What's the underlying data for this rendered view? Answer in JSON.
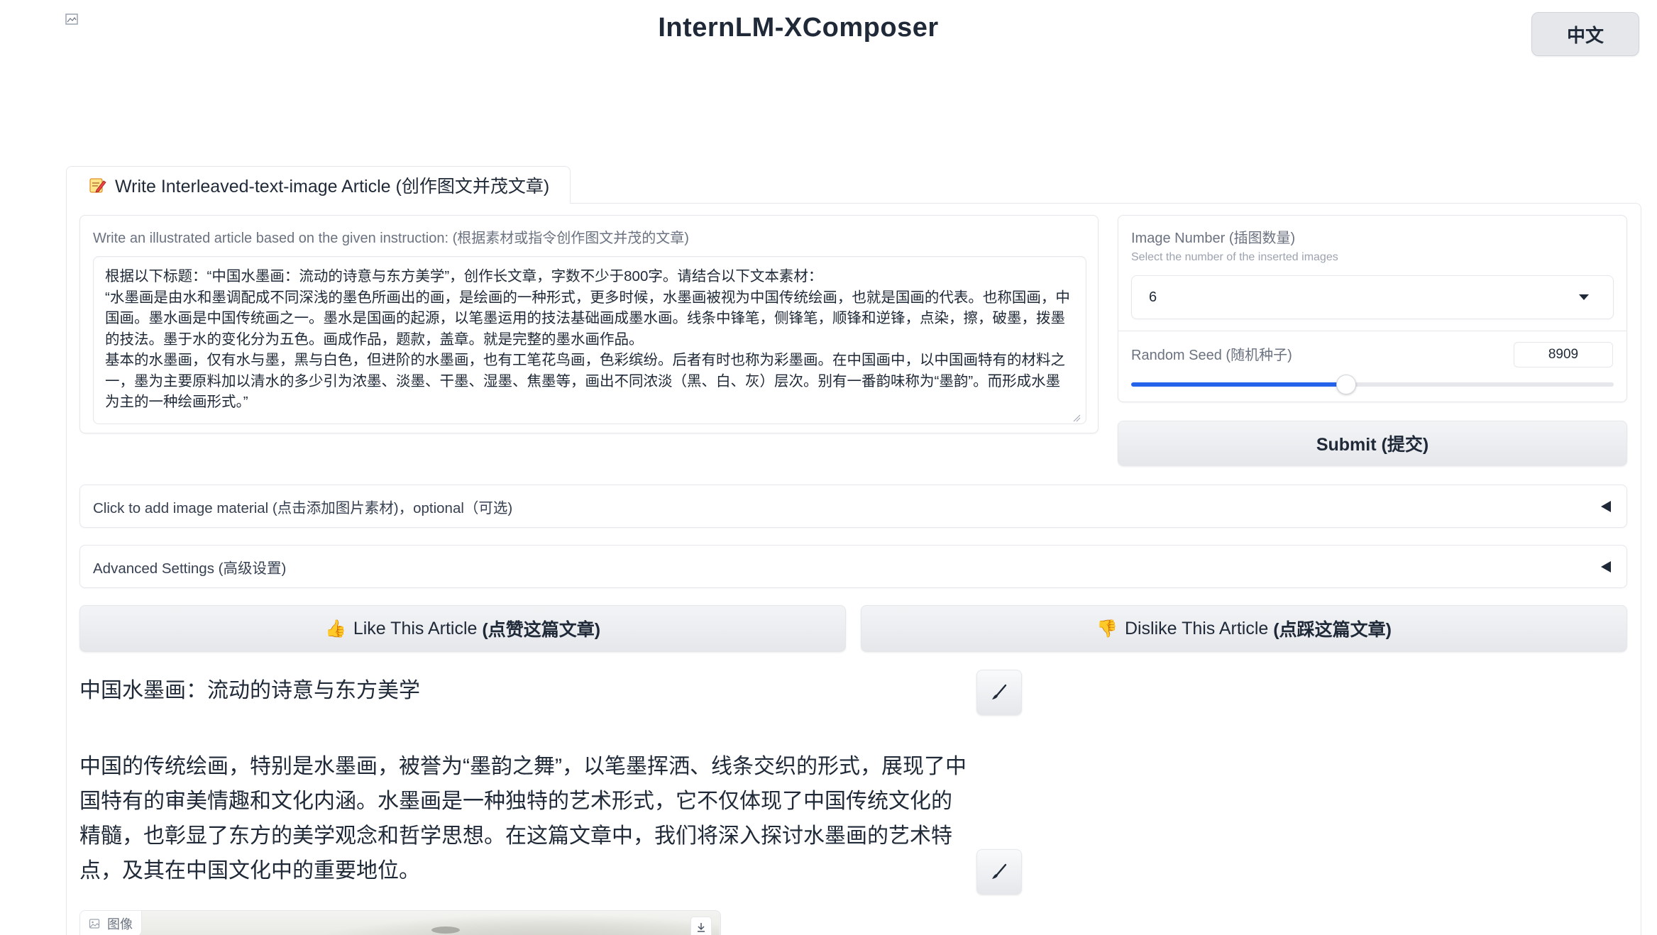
{
  "header": {
    "title": "InternLM-XComposer",
    "language_button": "中文"
  },
  "tabs": [
    {
      "label": "Write Interleaved-text-image Article (创作图文并茂文章)",
      "icon": "pencil-memo-icon"
    }
  ],
  "instruction": {
    "label": "Write an illustrated article based on the given instruction: (根据素材或指令创作图文并茂的文章)",
    "value": "根据以下标题：“中国水墨画：流动的诗意与东方美学”，创作长文章，字数不少于800字。请结合以下文本素材：\n“水墨画是由水和墨调配成不同深浅的墨色所画出的画，是绘画的一种形式，更多时候，水墨画被视为中国传统绘画，也就是国画的代表。也称国画，中国画。墨水画是中国传统画之一。墨水是国画的起源，以笔墨运用的技法基础画成墨水画。线条中锋笔，侧锋笔，顺锋和逆锋，点染，擦，破墨，拨墨的技法。墨于水的变化分为五色。画成作品，题款，盖章。就是完整的墨水画作品。\n基本的水墨画，仅有水与墨，黑与白色，但进阶的水墨画，也有工笔花鸟画，色彩缤纷。后者有时也称为彩墨画。在中国画中，以中国画特有的材料之一，墨为主要原料加以清水的多少引为浓墨、淡墨、干墨、湿墨、焦墨等，画出不同浓淡（黑、白、灰）层次。别有一番韵味称为“墨韵”。而形成水墨为主的一种绘画形式。”"
  },
  "settings": {
    "image_number_label": "Image Number (插图数量)",
    "image_number_info": "Select the number of the inserted images",
    "image_number_value": "6",
    "random_seed_label": "Random Seed (随机种子)",
    "random_seed_value": "8909",
    "random_seed_fraction": 0.445
  },
  "submit_label": "Submit (提交)",
  "accordions": {
    "image_material": "Click to add image material (点击添加图片素材)，optional（可选)",
    "advanced": "Advanced Settings (高级设置)"
  },
  "feedback": {
    "like_emoji": "👍",
    "like_text": "Like This Article",
    "like_cn": "(点赞这篇文章)",
    "dislike_emoji": "👎",
    "dislike_text": "Dislike This Article",
    "dislike_cn": "(点踩这篇文章)"
  },
  "article": {
    "heading": "中国水墨画：流动的诗意与东方美学",
    "paragraph": "中国的传统绘画，特别是水墨画，被誉为“墨韵之舞”，以笔墨挥洒、线条交织的形式，展现了中国特有的审美情趣和文化内涵。水墨画是一种独特的艺术形式，它不仅体现了中国传统文化的精髓，也彰显了东方的美学观念和哲学思想。在这篇文章中，我们将深入探讨水墨画的艺术特点，及其在中国文化中的重要地位。",
    "image_label": "图像"
  },
  "colors": {
    "accent": "#2563eb",
    "button_bg": "#e5e7eb",
    "border": "#e5e7eb"
  }
}
